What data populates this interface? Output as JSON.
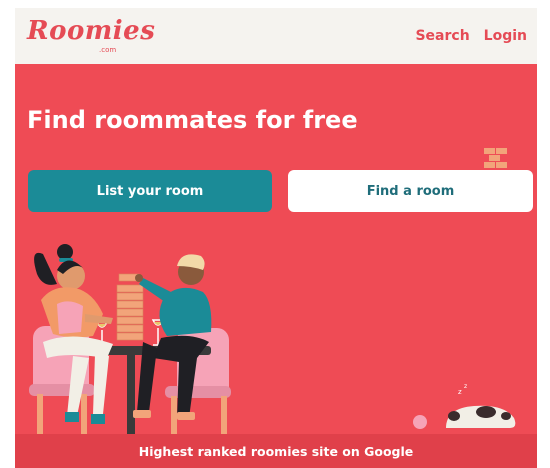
{
  "header": {
    "logo_text": "Roomies",
    "logo_suffix": ".com",
    "nav": [
      {
        "label": "Search"
      },
      {
        "label": "Login"
      }
    ]
  },
  "hero": {
    "headline": "Find roommates for free",
    "primary_button": "List your room",
    "secondary_button": "Find a room",
    "footer_text": "Highest ranked roomies site on Google"
  },
  "colors": {
    "brand": "#e54b55",
    "hero_bg": "#ef4b55",
    "primary_button": "#1b8b97",
    "header_bg": "#f5f3ef"
  },
  "icons": [
    "brick-stack-icon",
    "sleeping-dog-icon"
  ]
}
